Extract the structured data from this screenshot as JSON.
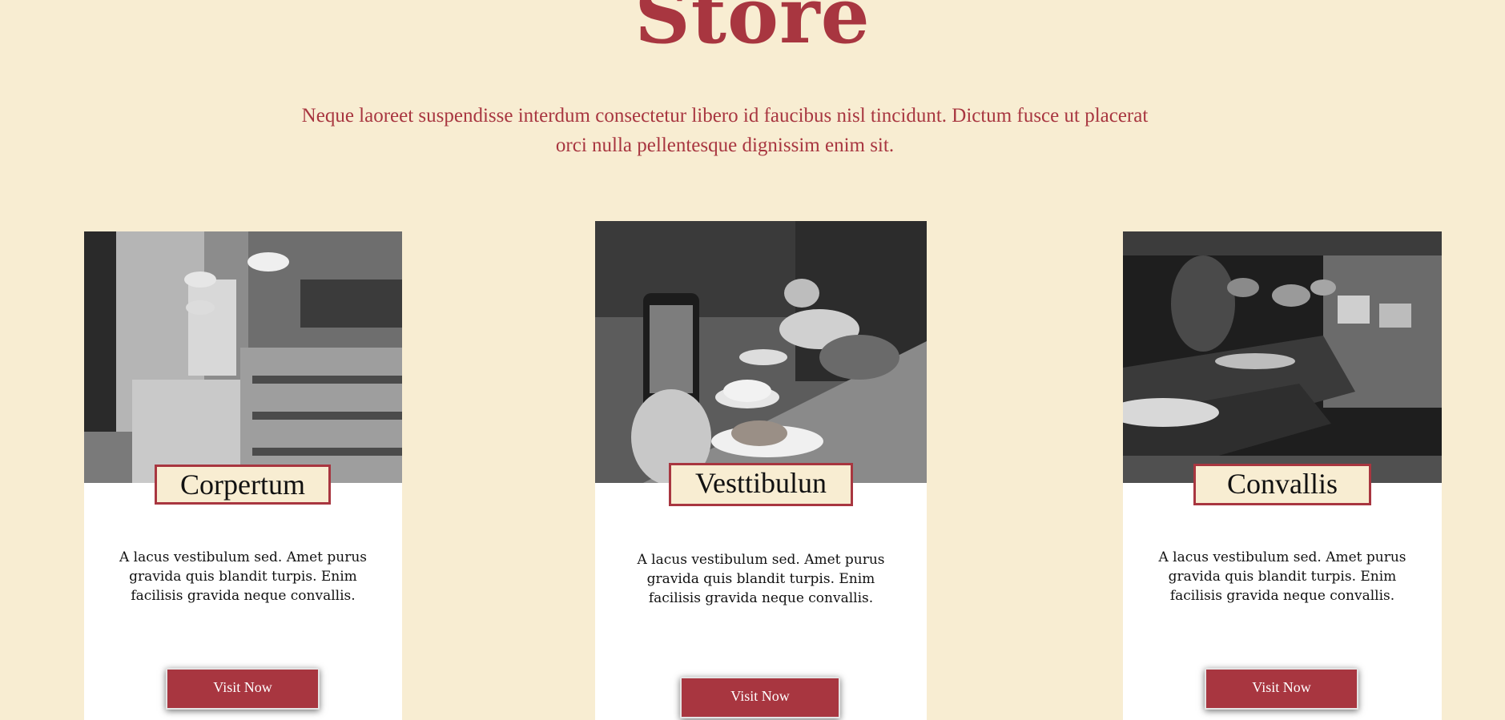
{
  "header": {
    "title": "Store",
    "subtitle": "Neque laoreet suspendisse interdum consectetur libero id faucibus nisl tincidunt. Dictum fusce ut placerat orci nulla pellentesque dignissim enim sit."
  },
  "cards": [
    {
      "label": "Corpertum",
      "description": "A lacus vestibulum sed. Amet purus gravida quis blandit turpis. Enim facilisis gravida neque convallis.",
      "button": "Visit Now",
      "image": "bakery-interior-photo"
    },
    {
      "label": "Vesttibulun",
      "description": "A lacus vestibulum sed. Amet purus gravida quis blandit turpis. Enim facilisis gravida neque convallis.",
      "button": "Visit Now",
      "image": "coffee-and-cake-photo"
    },
    {
      "label": "Convallis",
      "description": "A lacus vestibulum sed. Amet purus gravida quis blandit turpis. Enim facilisis gravida neque convallis.",
      "button": "Visit Now",
      "image": "lounge-interior-photo"
    }
  ],
  "colors": {
    "background": "#f8edd2",
    "accent": "#a83640",
    "card": "#ffffff"
  }
}
